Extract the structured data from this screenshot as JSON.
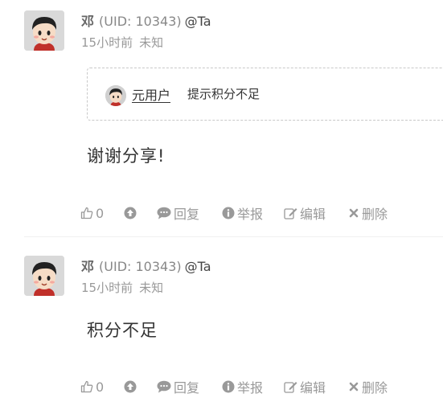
{
  "comments": [
    {
      "username": "邓",
      "uid": "(UID: 10343)",
      "at_label": "@Ta",
      "time_ago": "15小时前",
      "location": "未知",
      "quote": {
        "user": "元用户",
        "text": "提示积分不足"
      },
      "body": "谢谢分享!",
      "actions": {
        "like_count": "0",
        "reply": "回复",
        "report": "举报",
        "edit": "编辑",
        "delete": "删除"
      }
    },
    {
      "username": "邓",
      "uid": "(UID: 10343)",
      "at_label": "@Ta",
      "time_ago": "15小时前",
      "location": "未知",
      "body": "积分不足",
      "actions": {
        "like_count": "0",
        "reply": "回复",
        "report": "举报",
        "edit": "编辑",
        "delete": "删除"
      }
    }
  ],
  "icons": [
    "thumbs-up-icon",
    "arrow-up-circle-icon",
    "comment-bubble-icon",
    "info-circle-icon",
    "edit-icon",
    "close-x-icon"
  ],
  "colors": {
    "action_gray": "#999999",
    "text_dark": "#333333",
    "username_gray": "#666666"
  }
}
